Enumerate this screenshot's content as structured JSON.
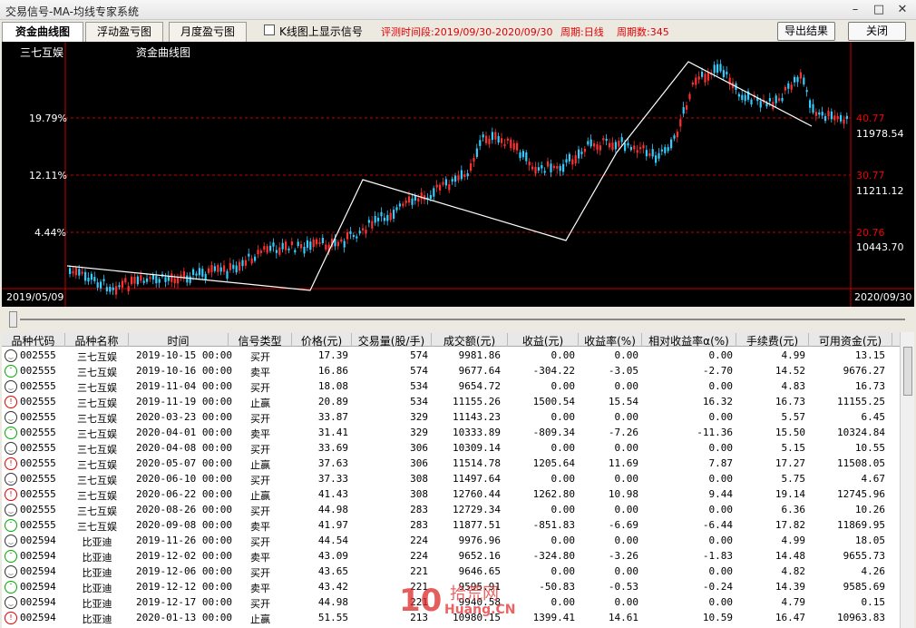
{
  "window": {
    "title": "交易信号-MA-均线专家系统",
    "min": "–",
    "max": "□",
    "close": "✕"
  },
  "tabs": [
    "资金曲线图",
    "浮动盈亏图",
    "月度盈亏图"
  ],
  "checkbox_label": "K线图上显示信号",
  "info": {
    "period": "评测时间段:2019/09/30-2020/09/30",
    "cycle": "周期:日线",
    "count": "周期数:345"
  },
  "buttons": {
    "export": "导出结果",
    "close": "关闭"
  },
  "chart": {
    "stock": "三七互娱",
    "title": "资金曲线图",
    "left_ticks": [
      "19.79%",
      "12.11%",
      "4.44%"
    ],
    "right_red": [
      "40.77",
      "30.77",
      "20.76"
    ],
    "right_white": [
      "11978.54",
      "11211.12",
      "10443.70"
    ],
    "start_date": "2019/05/09",
    "end_date": "2020/09/30"
  },
  "columns": [
    "品种代码",
    "品种名称",
    "时间",
    "信号类型",
    "价格(元)",
    "交易量(股/手)",
    "成交额(元)",
    "收益(元)",
    "收益率(%)",
    "相对收益率α(%)",
    "手续费(元)",
    "可用资金(元)"
  ],
  "rows": [
    [
      "002555",
      "三七互娱",
      "2019-10-15 00:00",
      "买开",
      "17.39",
      "574",
      "9981.86",
      "0.00",
      "0.00",
      "0.00",
      "4.99",
      "13.15"
    ],
    [
      "002555",
      "三七互娱",
      "2019-10-16 00:00",
      "卖平",
      "16.86",
      "574",
      "9677.64",
      "-304.22",
      "-3.05",
      "-2.70",
      "14.52",
      "9676.27"
    ],
    [
      "002555",
      "三七互娱",
      "2019-11-04 00:00",
      "买开",
      "18.08",
      "534",
      "9654.72",
      "0.00",
      "0.00",
      "0.00",
      "4.83",
      "16.73"
    ],
    [
      "002555",
      "三七互娱",
      "2019-11-19 00:00",
      "止赢",
      "20.89",
      "534",
      "11155.26",
      "1500.54",
      "15.54",
      "16.32",
      "16.73",
      "11155.25"
    ],
    [
      "002555",
      "三七互娱",
      "2020-03-23 00:00",
      "买开",
      "33.87",
      "329",
      "11143.23",
      "0.00",
      "0.00",
      "0.00",
      "5.57",
      "6.45"
    ],
    [
      "002555",
      "三七互娱",
      "2020-04-01 00:00",
      "卖平",
      "31.41",
      "329",
      "10333.89",
      "-809.34",
      "-7.26",
      "-11.36",
      "15.50",
      "10324.84"
    ],
    [
      "002555",
      "三七互娱",
      "2020-04-08 00:00",
      "买开",
      "33.69",
      "306",
      "10309.14",
      "0.00",
      "0.00",
      "0.00",
      "5.15",
      "10.55"
    ],
    [
      "002555",
      "三七互娱",
      "2020-05-07 00:00",
      "止赢",
      "37.63",
      "306",
      "11514.78",
      "1205.64",
      "11.69",
      "7.87",
      "17.27",
      "11508.05"
    ],
    [
      "002555",
      "三七互娱",
      "2020-06-10 00:00",
      "买开",
      "37.33",
      "308",
      "11497.64",
      "0.00",
      "0.00",
      "0.00",
      "5.75",
      "4.67"
    ],
    [
      "002555",
      "三七互娱",
      "2020-06-22 00:00",
      "止赢",
      "41.43",
      "308",
      "12760.44",
      "1262.80",
      "10.98",
      "9.44",
      "19.14",
      "12745.96"
    ],
    [
      "002555",
      "三七互娱",
      "2020-08-26 00:00",
      "买开",
      "44.98",
      "283",
      "12729.34",
      "0.00",
      "0.00",
      "0.00",
      "6.36",
      "10.26"
    ],
    [
      "002555",
      "三七互娱",
      "2020-09-08 00:00",
      "卖平",
      "41.97",
      "283",
      "11877.51",
      "-851.83",
      "-6.69",
      "-6.44",
      "17.82",
      "11869.95"
    ],
    [
      "002594",
      "比亚迪",
      "2019-11-26 00:00",
      "买开",
      "44.54",
      "224",
      "9976.96",
      "0.00",
      "0.00",
      "0.00",
      "4.99",
      "18.05"
    ],
    [
      "002594",
      "比亚迪",
      "2019-12-02 00:00",
      "卖平",
      "43.09",
      "224",
      "9652.16",
      "-324.80",
      "-3.26",
      "-1.83",
      "14.48",
      "9655.73"
    ],
    [
      "002594",
      "比亚迪",
      "2019-12-06 00:00",
      "买开",
      "43.65",
      "221",
      "9646.65",
      "0.00",
      "0.00",
      "0.00",
      "4.82",
      "4.26"
    ],
    [
      "002594",
      "比亚迪",
      "2019-12-12 00:00",
      "卖平",
      "43.42",
      "221",
      "9595.91",
      "-50.83",
      "-0.53",
      "-0.24",
      "14.39",
      "9585.69"
    ],
    [
      "002594",
      "比亚迪",
      "2019-12-17 00:00",
      "买开",
      "44.98",
      "221",
      "9940.58",
      "0.00",
      "0.00",
      "0.00",
      "4.79",
      "0.15"
    ],
    [
      "002594",
      "比亚迪",
      "2020-01-13 00:00",
      "止赢",
      "51.55",
      "213",
      "10980.15",
      "1399.41",
      "14.61",
      "10.59",
      "16.47",
      "10963.83"
    ]
  ],
  "watermark": {
    "brand": "拾荒网",
    "url": "Huang.CN",
    "num": "10"
  }
}
